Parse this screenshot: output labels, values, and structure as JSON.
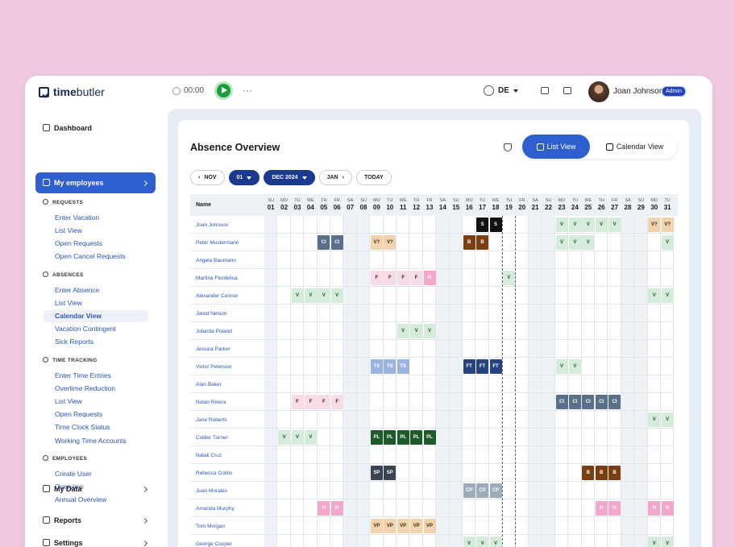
{
  "app": {
    "logo_bold": "time",
    "logo_rest": "butler",
    "timer": "00:00",
    "language": "DE",
    "user_name": "Joan Johnson",
    "user_role": "Admin"
  },
  "sidebar": {
    "dashboard": "Dashboard",
    "my_employees": "My employees",
    "requests_head": "REQUESTS",
    "requests": [
      "Enter Vacation",
      "List View",
      "Open Requests",
      "Open Cancel Requests"
    ],
    "absences_head": "ABSENCES",
    "absences": [
      "Enter Absence",
      "List View",
      "Calendar View",
      "Vacation Contingent",
      "Sick Reports"
    ],
    "time_head": "TIME TRACKING",
    "time": [
      "Enter Time Entries",
      "Overtime Reduction",
      "List View",
      "Open Requests",
      "Time Clock Status",
      "Working Time Accounts"
    ],
    "employees_head": "EMPLOYEES",
    "employees": [
      "Create User",
      "Overview",
      "Annual Overview"
    ],
    "my_data": "My Data",
    "reports": "Reports",
    "settings": "Settings"
  },
  "page": {
    "title": "Absence Overview",
    "list_view": "List View",
    "calendar_view": "Calendar View",
    "nav": {
      "prev": "NOV",
      "day": "01",
      "month": "DEC 2024",
      "next": "JAN",
      "today": "TODAY"
    },
    "name_header": "Name"
  },
  "colors": {
    "accent": "#2f5fcf",
    "V": "#d4ecd9",
    "VQ": "#f3d3ad",
    "CI": "#5a6f89",
    "F": "#f9dbe8",
    "H": "#f3a8cb",
    "TS": "#9bb3e0",
    "FT": "#25447f",
    "PL": "#1e5a2a",
    "SP": "#3a4451",
    "CP": "#9fabbb",
    "B": "#7a3e10",
    "VP": "#f3d3ad",
    "S": "#111111"
  },
  "chart_data": {
    "days": [
      {
        "d": "SU",
        "n": "01"
      },
      {
        "d": "MO",
        "n": "02"
      },
      {
        "d": "TU",
        "n": "03"
      },
      {
        "d": "WE",
        "n": "04"
      },
      {
        "d": "TH",
        "n": "05"
      },
      {
        "d": "FR",
        "n": "06"
      },
      {
        "d": "SA",
        "n": "07"
      },
      {
        "d": "SU",
        "n": "08"
      },
      {
        "d": "MO",
        "n": "09"
      },
      {
        "d": "TU",
        "n": "10"
      },
      {
        "d": "WE",
        "n": "11"
      },
      {
        "d": "TH",
        "n": "12"
      },
      {
        "d": "FR",
        "n": "13"
      },
      {
        "d": "SA",
        "n": "14"
      },
      {
        "d": "SU",
        "n": "15"
      },
      {
        "d": "MO",
        "n": "16"
      },
      {
        "d": "TU",
        "n": "17"
      },
      {
        "d": "WE",
        "n": "18"
      },
      {
        "d": "TH",
        "n": "19"
      },
      {
        "d": "FR",
        "n": "20"
      },
      {
        "d": "SA",
        "n": "21"
      },
      {
        "d": "SU",
        "n": "22"
      },
      {
        "d": "MO",
        "n": "23"
      },
      {
        "d": "TU",
        "n": "24"
      },
      {
        "d": "WE",
        "n": "25"
      },
      {
        "d": "TH",
        "n": "26"
      },
      {
        "d": "FR",
        "n": "27"
      },
      {
        "d": "SA",
        "n": "28"
      },
      {
        "d": "SU",
        "n": "29"
      },
      {
        "d": "MO",
        "n": "30"
      },
      {
        "d": "TU",
        "n": "31"
      }
    ],
    "rows": [
      {
        "name": "Joan Johnson",
        "marks": [
          [
            17,
            "S"
          ],
          [
            18,
            "S"
          ],
          [
            23,
            "V"
          ],
          [
            24,
            "V"
          ],
          [
            25,
            "V"
          ],
          [
            26,
            "V"
          ],
          [
            27,
            "V"
          ],
          [
            30,
            "V?"
          ],
          [
            31,
            "V?"
          ]
        ]
      },
      {
        "name": "Peter Mustermann",
        "marks": [
          [
            5,
            "CI"
          ],
          [
            6,
            "CI"
          ],
          [
            9,
            "V?"
          ],
          [
            10,
            "V?"
          ],
          [
            16,
            "B"
          ],
          [
            17,
            "B"
          ],
          [
            23,
            "V"
          ],
          [
            24,
            "V"
          ],
          [
            25,
            "V"
          ],
          [
            31,
            "V"
          ]
        ]
      },
      {
        "name": "Angela Baumann",
        "marks": []
      },
      {
        "name": "Martina Flordelisa",
        "marks": [
          [
            9,
            "F"
          ],
          [
            10,
            "F"
          ],
          [
            11,
            "F"
          ],
          [
            12,
            "F"
          ],
          [
            13,
            "H"
          ],
          [
            19,
            "V"
          ]
        ]
      },
      {
        "name": "Alexander Connor",
        "marks": [
          [
            3,
            "V"
          ],
          [
            4,
            "V"
          ],
          [
            5,
            "V"
          ],
          [
            6,
            "V"
          ],
          [
            30,
            "V"
          ],
          [
            31,
            "V"
          ]
        ]
      },
      {
        "name": "Jared Nelson",
        "marks": []
      },
      {
        "name": "Jolanda Poland",
        "marks": [
          [
            11,
            "V"
          ],
          [
            12,
            "V"
          ],
          [
            13,
            "V"
          ]
        ]
      },
      {
        "name": "Jessica Parker",
        "marks": []
      },
      {
        "name": "Victor Peterson",
        "marks": [
          [
            9,
            "TS"
          ],
          [
            10,
            "TS"
          ],
          [
            11,
            "TS"
          ],
          [
            16,
            "FT"
          ],
          [
            17,
            "FT"
          ],
          [
            18,
            "FT"
          ],
          [
            23,
            "V"
          ],
          [
            24,
            "V"
          ]
        ]
      },
      {
        "name": "Alan Baker",
        "marks": []
      },
      {
        "name": "Nolan Rivera",
        "marks": [
          [
            3,
            "F"
          ],
          [
            4,
            "F"
          ],
          [
            5,
            "F"
          ],
          [
            6,
            "F"
          ],
          [
            23,
            "CI"
          ],
          [
            24,
            "CI"
          ],
          [
            25,
            "CI"
          ],
          [
            26,
            "CI"
          ],
          [
            27,
            "CI"
          ]
        ]
      },
      {
        "name": "Jane Roberts",
        "marks": [
          [
            30,
            "V"
          ],
          [
            31,
            "V"
          ]
        ]
      },
      {
        "name": "Colder Turner",
        "marks": [
          [
            2,
            "V"
          ],
          [
            3,
            "V"
          ],
          [
            4,
            "V"
          ],
          [
            9,
            "PL"
          ],
          [
            10,
            "PL"
          ],
          [
            11,
            "PL"
          ],
          [
            12,
            "PL"
          ],
          [
            13,
            "PL"
          ]
        ]
      },
      {
        "name": "Natali Cruz",
        "marks": []
      },
      {
        "name": "Rebecca Colins",
        "marks": [
          [
            9,
            "SP"
          ],
          [
            10,
            "SP"
          ],
          [
            25,
            "B"
          ],
          [
            26,
            "B"
          ],
          [
            27,
            "B"
          ]
        ]
      },
      {
        "name": "Juan Morales",
        "marks": [
          [
            16,
            "CP"
          ],
          [
            17,
            "CP"
          ],
          [
            18,
            "CP"
          ]
        ]
      },
      {
        "name": "Amanda Murphy",
        "marks": [
          [
            5,
            "H"
          ],
          [
            6,
            "H"
          ],
          [
            26,
            "H"
          ],
          [
            27,
            "H"
          ],
          [
            30,
            "H"
          ],
          [
            31,
            "H"
          ]
        ]
      },
      {
        "name": "Tom Morgan",
        "marks": [
          [
            9,
            "VP"
          ],
          [
            10,
            "VP"
          ],
          [
            11,
            "VP"
          ],
          [
            12,
            "VP"
          ],
          [
            13,
            "VP"
          ]
        ]
      },
      {
        "name": "George Cooper",
        "marks": [
          [
            16,
            "V"
          ],
          [
            17,
            "V"
          ],
          [
            18,
            "V"
          ],
          [
            30,
            "V"
          ],
          [
            31,
            "V"
          ]
        ]
      }
    ]
  }
}
